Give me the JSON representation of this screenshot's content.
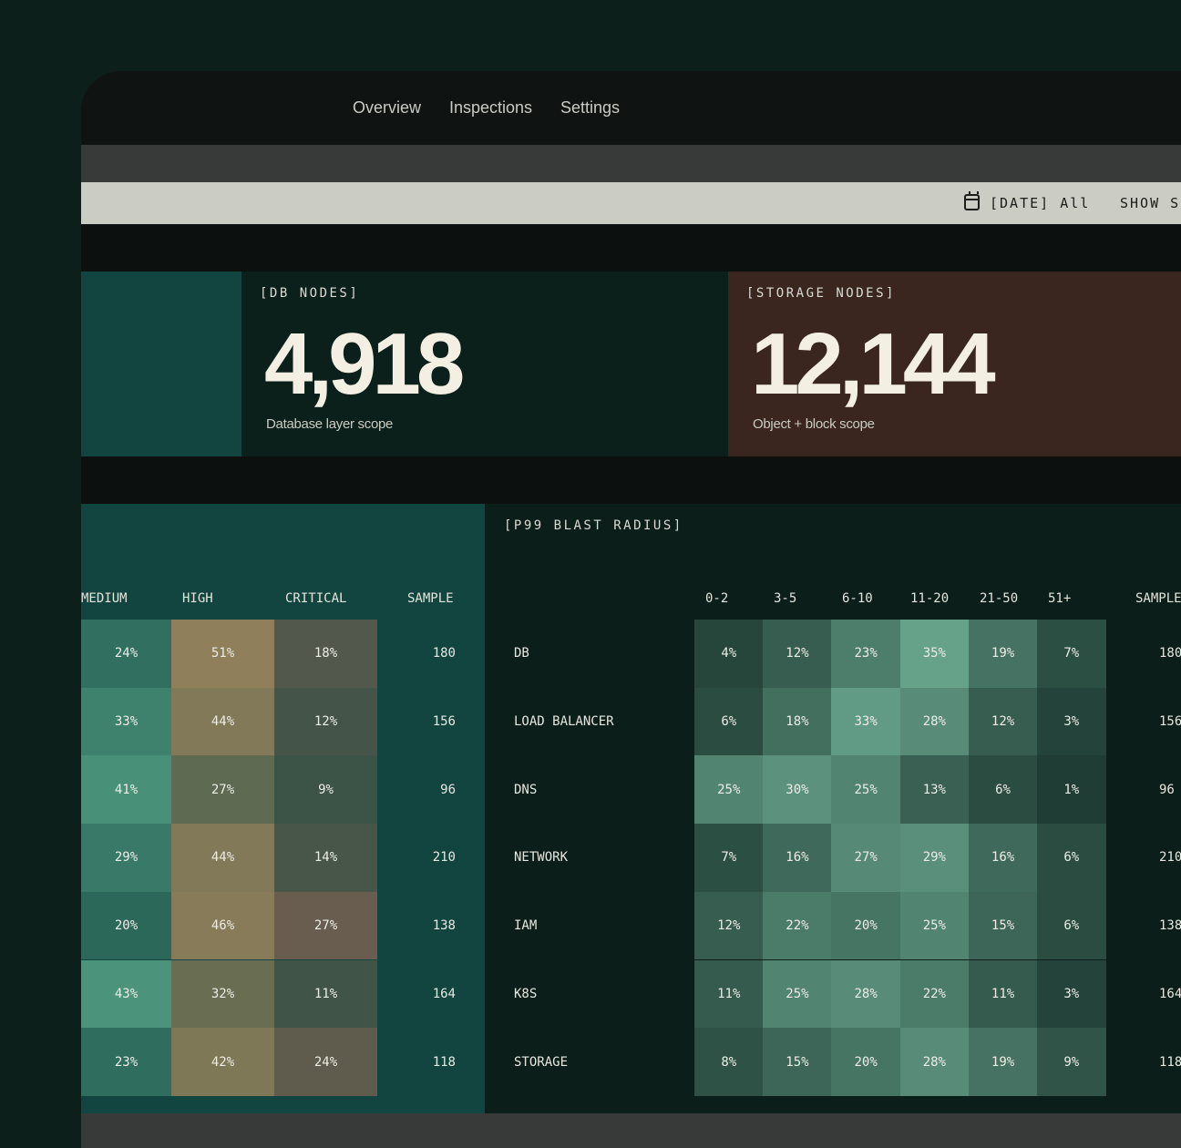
{
  "nav": {
    "items": [
      "Overview",
      "Inspections",
      "Settings"
    ]
  },
  "filters": {
    "date_label": "[DATE] All",
    "show_label": "SHOW SC"
  },
  "stats": [
    {
      "label": "[DB NODES]",
      "value": "4,918",
      "sub": "Database layer scope",
      "color": "#0b1f1b"
    },
    {
      "label": "[STORAGE NODES]",
      "value": "12,144",
      "sub": "Object + block scope",
      "color": "#3a261f"
    }
  ],
  "severity_table": {
    "columns": [
      "MEDIUM",
      "HIGH",
      "CRITICAL",
      "SAMPLE"
    ],
    "rows": [
      {
        "medium": "24%",
        "high": "51%",
        "critical": "18%",
        "sample": "180"
      },
      {
        "medium": "33%",
        "high": "44%",
        "critical": "12%",
        "sample": "156"
      },
      {
        "medium": "41%",
        "high": "27%",
        "critical": "9%",
        "sample": "96"
      },
      {
        "medium": "29%",
        "high": "44%",
        "critical": "14%",
        "sample": "210"
      },
      {
        "medium": "20%",
        "high": "46%",
        "critical": "27%",
        "sample": "138"
      },
      {
        "medium": "43%",
        "high": "32%",
        "critical": "11%",
        "sample": "164"
      },
      {
        "medium": "23%",
        "high": "42%",
        "critical": "24%",
        "sample": "118"
      }
    ]
  },
  "blast_table": {
    "title": "[P99 BLAST RADIUS]",
    "columns": [
      "0-2",
      "3-5",
      "6-10",
      "11-20",
      "21-50",
      "51+"
    ],
    "sample_header": "SAMPLE",
    "rows": [
      {
        "label": "DB",
        "values": [
          "4%",
          "12%",
          "23%",
          "35%",
          "19%",
          "7%"
        ],
        "sample": "180"
      },
      {
        "label": "LOAD BALANCER",
        "values": [
          "6%",
          "18%",
          "33%",
          "28%",
          "12%",
          "3%"
        ],
        "sample": "156"
      },
      {
        "label": "DNS",
        "values": [
          "25%",
          "30%",
          "25%",
          "13%",
          "6%",
          "1%"
        ],
        "sample": "96"
      },
      {
        "label": "NETWORK",
        "values": [
          "7%",
          "16%",
          "27%",
          "29%",
          "16%",
          "6%"
        ],
        "sample": "210"
      },
      {
        "label": "IAM",
        "values": [
          "12%",
          "22%",
          "20%",
          "25%",
          "15%",
          "6%"
        ],
        "sample": "138"
      },
      {
        "label": "K8S",
        "values": [
          "11%",
          "25%",
          "28%",
          "22%",
          "11%",
          "3%"
        ],
        "sample": "164"
      },
      {
        "label": "STORAGE",
        "values": [
          "8%",
          "15%",
          "20%",
          "28%",
          "19%",
          "9%"
        ],
        "sample": "118"
      }
    ]
  }
}
